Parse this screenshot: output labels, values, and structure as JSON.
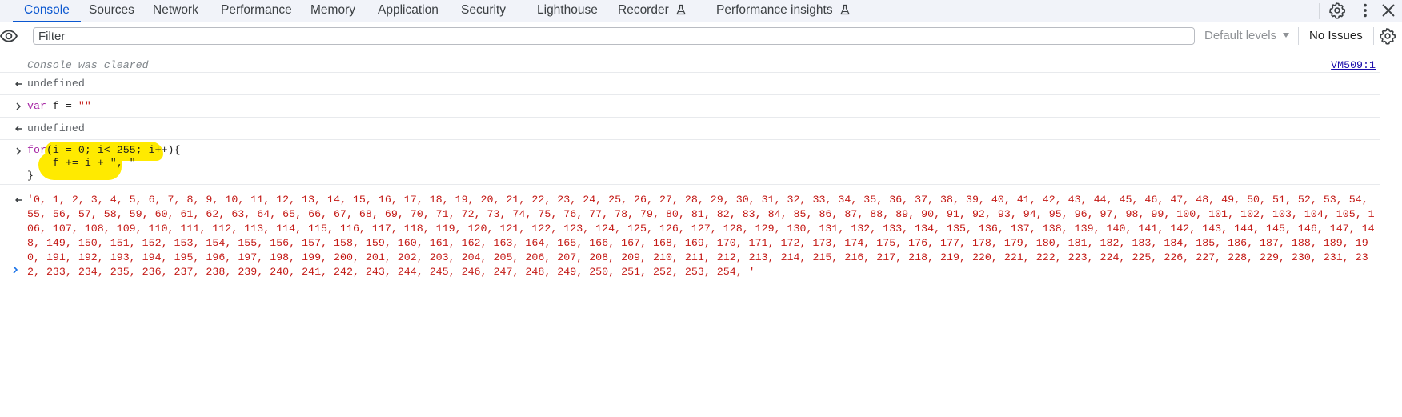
{
  "tabs": [
    {
      "label": "Console",
      "active": true
    },
    {
      "label": "Sources"
    },
    {
      "label": "Network"
    },
    {
      "label": "Performance"
    },
    {
      "label": "Memory"
    },
    {
      "label": "Application"
    },
    {
      "label": "Security"
    },
    {
      "label": "Lighthouse"
    },
    {
      "label": "Recorder",
      "icon": "flask-icon"
    },
    {
      "label": "Performance insights",
      "icon": "flask-icon"
    }
  ],
  "toolbar_icons": [
    "settings-gear-icon",
    "more-vertical-icon",
    "close-icon"
  ],
  "filter": {
    "eye_icon": "eye-icon",
    "placeholder": "Filter",
    "value": "",
    "levels_label": "Default levels",
    "issues_label": "No Issues",
    "settings_icon": "settings-gear-icon"
  },
  "console": {
    "cleared_message": "Console was cleared",
    "cleared_source": "VM509:1",
    "output_1": "undefined",
    "input_1": {
      "keyword": "var",
      "rest": " f = ",
      "string": "\"\""
    },
    "output_2": "undefined",
    "input_2": {
      "line1_kw": "for",
      "line1_rest": "(i = 0; i< 255; i++){",
      "line2": "    f += i + \", \"",
      "line3": "}"
    },
    "result": "'0, 1, 2, 3, 4, 5, 6, 7, 8, 9, 10, 11, 12, 13, 14, 15, 16, 17, 18, 19, 20, 21, 22, 23, 24, 25, 26, 27, 28, 29, 30, 31, 32, 33, 34, 35, 36, 37, 38, 39, 40, 41, 42, 43, 44, 45, 46, 47, 48, 49, 50, 51, 52, 53, 54, 55, 56, 57, 58, 59, 60, 61, 62, 63, 64, 65, 66, 67, 68, 69, 70, 71, 72, 73, 74, 75, 76, 77, 78, 79, 80, 81, 82, 83, 84, 85, 86, 87, 88, 89, 90, 91, 92, 93, 94, 95, 96, 97, 98, 99, 100, 101, 102, 103, 104, 105, 106, 107, 108, 109, 110, 111, 112, 113, 114, 115, 116, 117, 118, 119, 120, 121, 122, 123, 124, 125, 126, 127, 128, 129, 130, 131, 132, 133, 134, 135, 136, 137, 138, 139, 140, 141, 142, 143, 144, 145, 146, 147, 148, 149, 150, 151, 152, 153, 154, 155, 156, 157, 158, 159, 160, 161, 162, 163, 164, 165, 166, 167, 168, 169, 170, 171, 172, 173, 174, 175, 176, 177, 178, 179, 180, 181, 182, 183, 184, 185, 186, 187, 188, 189, 190, 191, 192, 193, 194, 195, 196, 197, 198, 199, 200, 201, 202, 203, 204, 205, 206, 207, 208, 209, 210, 211, 212, 213, 214, 215, 216, 217, 218, 219, 220, 221, 222, 223, 224, 225, 226, 227, 228, 229, 230, 231, 232, 233, 234, 235, 236, 237, 238, 239, 240, 241, 242, 243, 244, 245, 246, 247, 248, 249, 250, 251, 252, 253, 254, '"
  },
  "colors": {
    "accent": "#0b57d0",
    "string": "#c41a16",
    "keyword": "#a626a4",
    "highlight": "#ffea00"
  }
}
